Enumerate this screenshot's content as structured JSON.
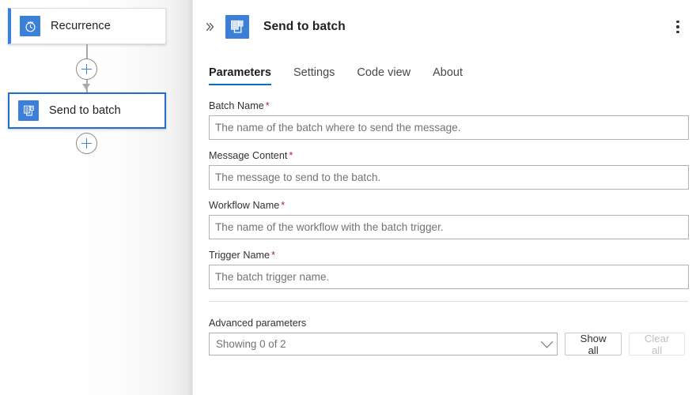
{
  "canvas": {
    "nodes": [
      {
        "label": "Recurrence",
        "icon": "clock-icon",
        "state": "trigger"
      },
      {
        "label": "Send to batch",
        "icon": "batch-document-icon",
        "state": "selected"
      }
    ],
    "add_buttons": [
      {
        "name": "insert-step-between-recurrence-and-send-to-batch",
        "icon": "plus-icon"
      },
      {
        "name": "insert-step-after-send-to-batch",
        "icon": "plus-icon"
      }
    ],
    "accent_color": "#3b7fd9",
    "selected_border_color": "#1f6fd0"
  },
  "panel": {
    "collapse_icon": "double-chevron-right-icon",
    "title": "Send to batch",
    "title_icon": "batch-document-icon",
    "menu_icon": "more-vertical-icon",
    "tabs": [
      {
        "label": "Parameters",
        "active": true
      },
      {
        "label": "Settings",
        "active": false
      },
      {
        "label": "Code view",
        "active": false
      },
      {
        "label": "About",
        "active": false
      }
    ],
    "active_tab_color": "#0f6cbd",
    "fields": [
      {
        "label": "Batch Name",
        "required": true,
        "value": "",
        "placeholder": "The name of the batch where to send the message."
      },
      {
        "label": "Message Content",
        "required": true,
        "value": "",
        "placeholder": "The message to send to the batch."
      },
      {
        "label": "Workflow Name",
        "required": true,
        "value": "",
        "placeholder": "The name of the workflow with the batch trigger."
      },
      {
        "label": "Trigger Name",
        "required": true,
        "value": "",
        "placeholder": "The batch trigger name."
      }
    ],
    "advanced": {
      "label": "Advanced parameters",
      "select_value": "Showing 0 of 2",
      "select_icon": "chevron-down-icon",
      "show_all_label": "Show all",
      "clear_all_label": "Clear all",
      "clear_all_disabled": true
    }
  }
}
